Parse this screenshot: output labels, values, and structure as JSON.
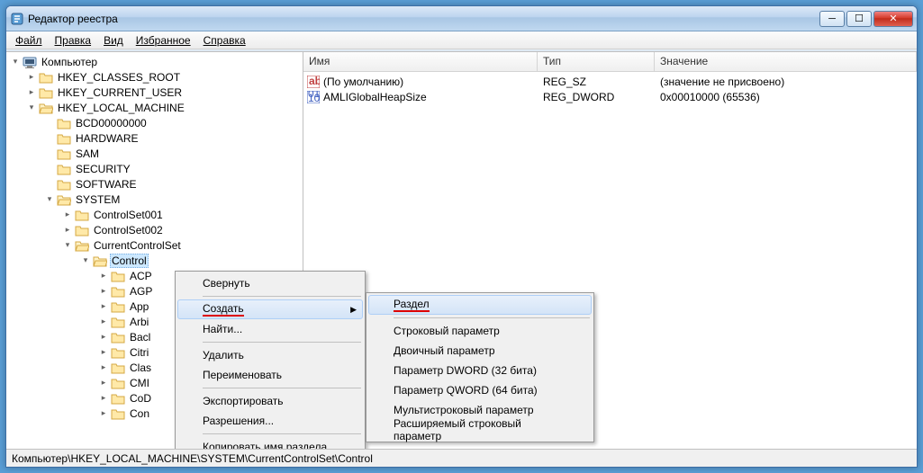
{
  "title": "Редактор реестра",
  "menus": {
    "file": "Файл",
    "edit": "Правка",
    "view": "Вид",
    "fav": "Избранное",
    "help": "Справка"
  },
  "tree": {
    "root": "Компьютер",
    "hkcr": "HKEY_CLASSES_ROOT",
    "hkcu": "HKEY_CURRENT_USER",
    "hklm": "HKEY_LOCAL_MACHINE",
    "children": [
      "BCD00000000",
      "HARDWARE",
      "SAM",
      "SECURITY",
      "SOFTWARE",
      "SYSTEM"
    ],
    "system_children": [
      "ControlSet001",
      "ControlSet002",
      "CurrentControlSet"
    ],
    "control": "Control",
    "control_children": [
      "ACP",
      "AGP",
      "App",
      "Arbi",
      "Bacl",
      "Citri",
      "Clas",
      "CMI",
      "CoD",
      "Con"
    ]
  },
  "list": {
    "headers": {
      "name": "Имя",
      "type": "Тип",
      "value": "Значение"
    },
    "rows": [
      {
        "name": "(По умолчанию)",
        "type": "REG_SZ",
        "value": "(значение не присвоено)",
        "kind": "sz"
      },
      {
        "name": "AMLIGlobalHeapSize",
        "type": "REG_DWORD",
        "value": "0x00010000 (65536)",
        "kind": "dw"
      }
    ]
  },
  "context1": {
    "collapse": "Свернуть",
    "create": "Создать",
    "find": "Найти...",
    "delete": "Удалить",
    "rename": "Переименовать",
    "export": "Экспортировать",
    "perms": "Разрешения...",
    "copyname": "Копировать имя раздела"
  },
  "context2": {
    "section": "Раздел",
    "string": "Строковый параметр",
    "binary": "Двоичный параметр",
    "dword": "Параметр DWORD (32 бита)",
    "qword": "Параметр QWORD (64 бита)",
    "mstring": "Мультистроковый параметр",
    "estring": "Расширяемый строковый параметр"
  },
  "status": "Компьютер\\HKEY_LOCAL_MACHINE\\SYSTEM\\CurrentControlSet\\Control"
}
